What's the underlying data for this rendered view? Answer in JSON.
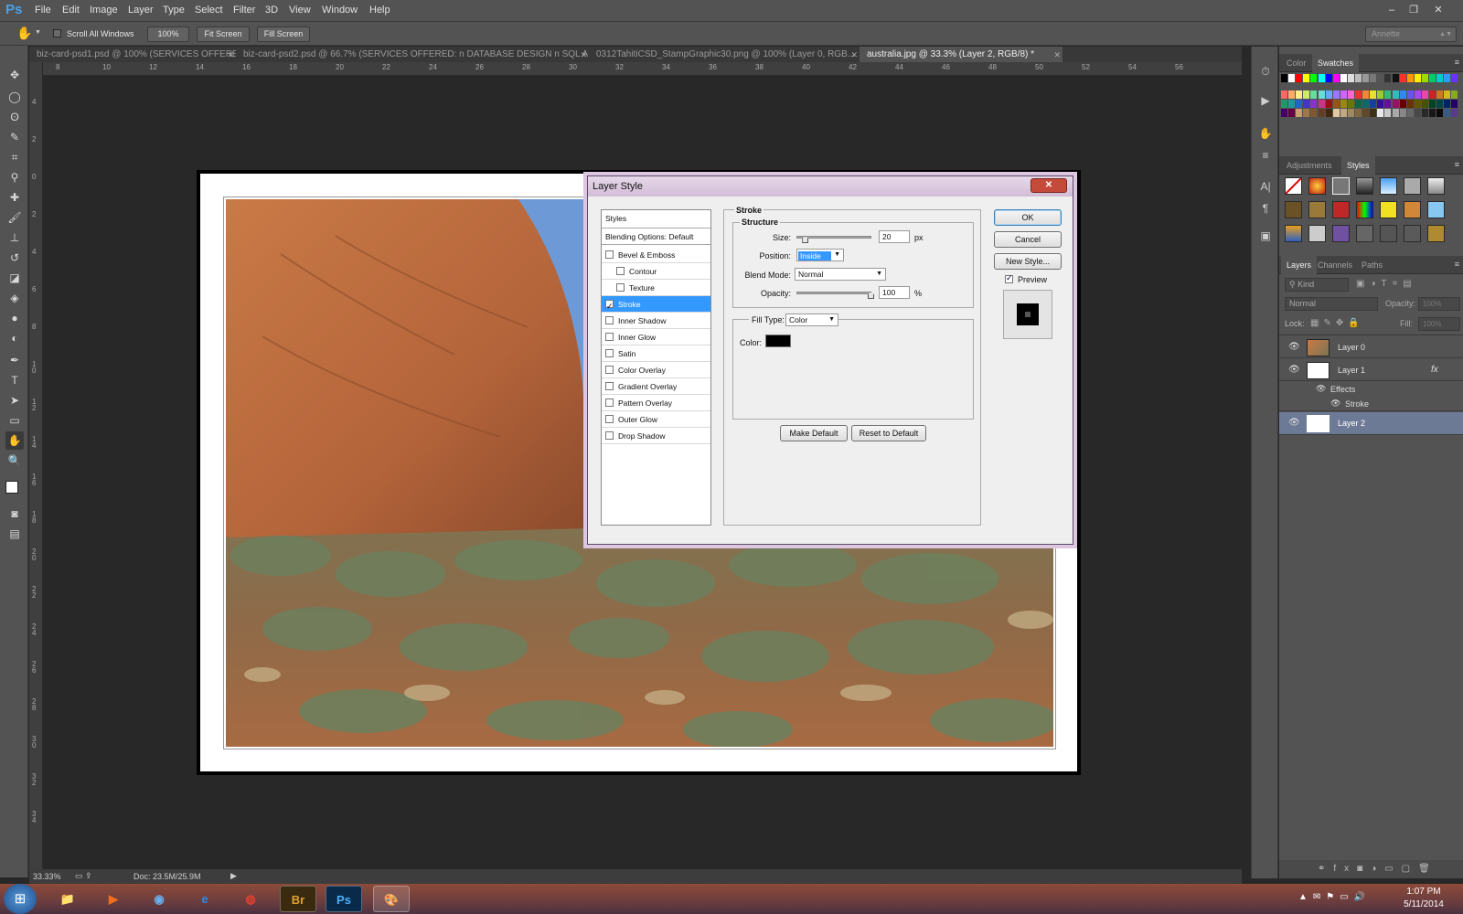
{
  "app": {
    "logo": "Ps"
  },
  "menu": [
    "File",
    "Edit",
    "Image",
    "Layer",
    "Type",
    "Select",
    "Filter",
    "3D",
    "View",
    "Window",
    "Help"
  ],
  "window_controls": {
    "minimize": "–",
    "restore": "❐",
    "close": "✕"
  },
  "options_bar": {
    "scroll_all_windows": "Scroll All Windows",
    "zoom_100": "100%",
    "fit_screen": "Fit Screen",
    "fill_screen": "Fill Screen",
    "workspace": "Annette"
  },
  "tabs": [
    "biz-card-psd1.psd @ 100% (SERVICES OFFERED: n   Computer Repair    n Virus Rem...",
    "biz-card-psd2.psd @ 66.7% (SERVICES OFFERED: n   DATABASE DESIGN n SQL AND ...",
    "0312TahitiCSD_StampGraphic30.png @ 100% (Layer 0, RGB...",
    "australia.jpg @ 33.3% (Layer 2, RGB/8) *"
  ],
  "ruler_top": [
    "8",
    "10",
    "12",
    "14",
    "16",
    "18",
    "20",
    "22",
    "24",
    "26",
    "28",
    "30",
    "32",
    "34",
    "36",
    "38",
    "40",
    "42",
    "44",
    "46",
    "48",
    "50",
    "52",
    "54",
    "56"
  ],
  "ruler_left": [
    "4",
    "2",
    "0",
    "2",
    "4",
    "6",
    "8",
    "1 0",
    "1 2",
    "1 4",
    "1 6",
    "1 8",
    "2 0",
    "2 2",
    "2 4",
    "2 6",
    "2 8",
    "3 0",
    "3 2",
    "3 4"
  ],
  "status": {
    "zoom": "33.33%",
    "doc": "Doc: 23.5M/25.9M"
  },
  "dialog": {
    "title": "Layer Style",
    "close": "✕",
    "styles_header": "Styles",
    "blending": "Blending Options: Default",
    "items": [
      {
        "label": "Bevel & Emboss",
        "checked": false,
        "indent": false
      },
      {
        "label": "Contour",
        "checked": false,
        "indent": true
      },
      {
        "label": "Texture",
        "checked": false,
        "indent": true
      },
      {
        "label": "Stroke",
        "checked": true,
        "indent": false
      },
      {
        "label": "Inner Shadow",
        "checked": false,
        "indent": false
      },
      {
        "label": "Inner Glow",
        "checked": false,
        "indent": false
      },
      {
        "label": "Satin",
        "checked": false,
        "indent": false
      },
      {
        "label": "Color Overlay",
        "checked": false,
        "indent": false
      },
      {
        "label": "Gradient Overlay",
        "checked": false,
        "indent": false
      },
      {
        "label": "Pattern Overlay",
        "checked": false,
        "indent": false
      },
      {
        "label": "Outer Glow",
        "checked": false,
        "indent": false
      },
      {
        "label": "Drop Shadow",
        "checked": false,
        "indent": false
      }
    ],
    "section_title": "Stroke",
    "structure_title": "Structure",
    "size_label": "Size:",
    "size_value": "20",
    "size_unit": "px",
    "size_fraction": 0.08,
    "position_label": "Position:",
    "position_value": "Inside",
    "blend_label": "Blend Mode:",
    "blend_value": "Normal",
    "opacity_label": "Opacity:",
    "opacity_value": "100",
    "opacity_unit": "%",
    "opacity_fraction": 1.0,
    "fill_type_label": "Fill Type:",
    "fill_type_value": "Color",
    "color_label": "Color:",
    "stroke_color": "#000000",
    "make_default": "Make Default",
    "reset_default": "Reset to Default",
    "ok": "OK",
    "cancel": "Cancel",
    "new_style": "New Style...",
    "preview_label": "Preview",
    "preview_checked": true
  },
  "panels": {
    "color_tabs": [
      "Color",
      "Swatches"
    ],
    "style_tabs": [
      "Adjustments",
      "Styles"
    ],
    "layer_tabs": [
      "Layers",
      "Channels",
      "Paths"
    ],
    "kind": "Kind",
    "blend": "Normal",
    "opacity_label": "Opacity:",
    "opacity_value": "100%",
    "lock_label": "Lock:",
    "fill_label": "Fill:",
    "fill_value": "100%",
    "layers": [
      {
        "name": "Layer 0",
        "fx": ""
      },
      {
        "name": "Layer 1",
        "fx": "fx"
      }
    ],
    "effects_label": "Effects",
    "stroke_label": "Stroke",
    "layer2": "Layer 2"
  },
  "taskbar": {
    "time": "1:07 PM",
    "date": "5/11/2014",
    "apps": [
      "Br",
      "Ps"
    ]
  },
  "colors": {
    "accent": "#3399ff",
    "chrome": "#535353",
    "canvas": "#282828"
  }
}
